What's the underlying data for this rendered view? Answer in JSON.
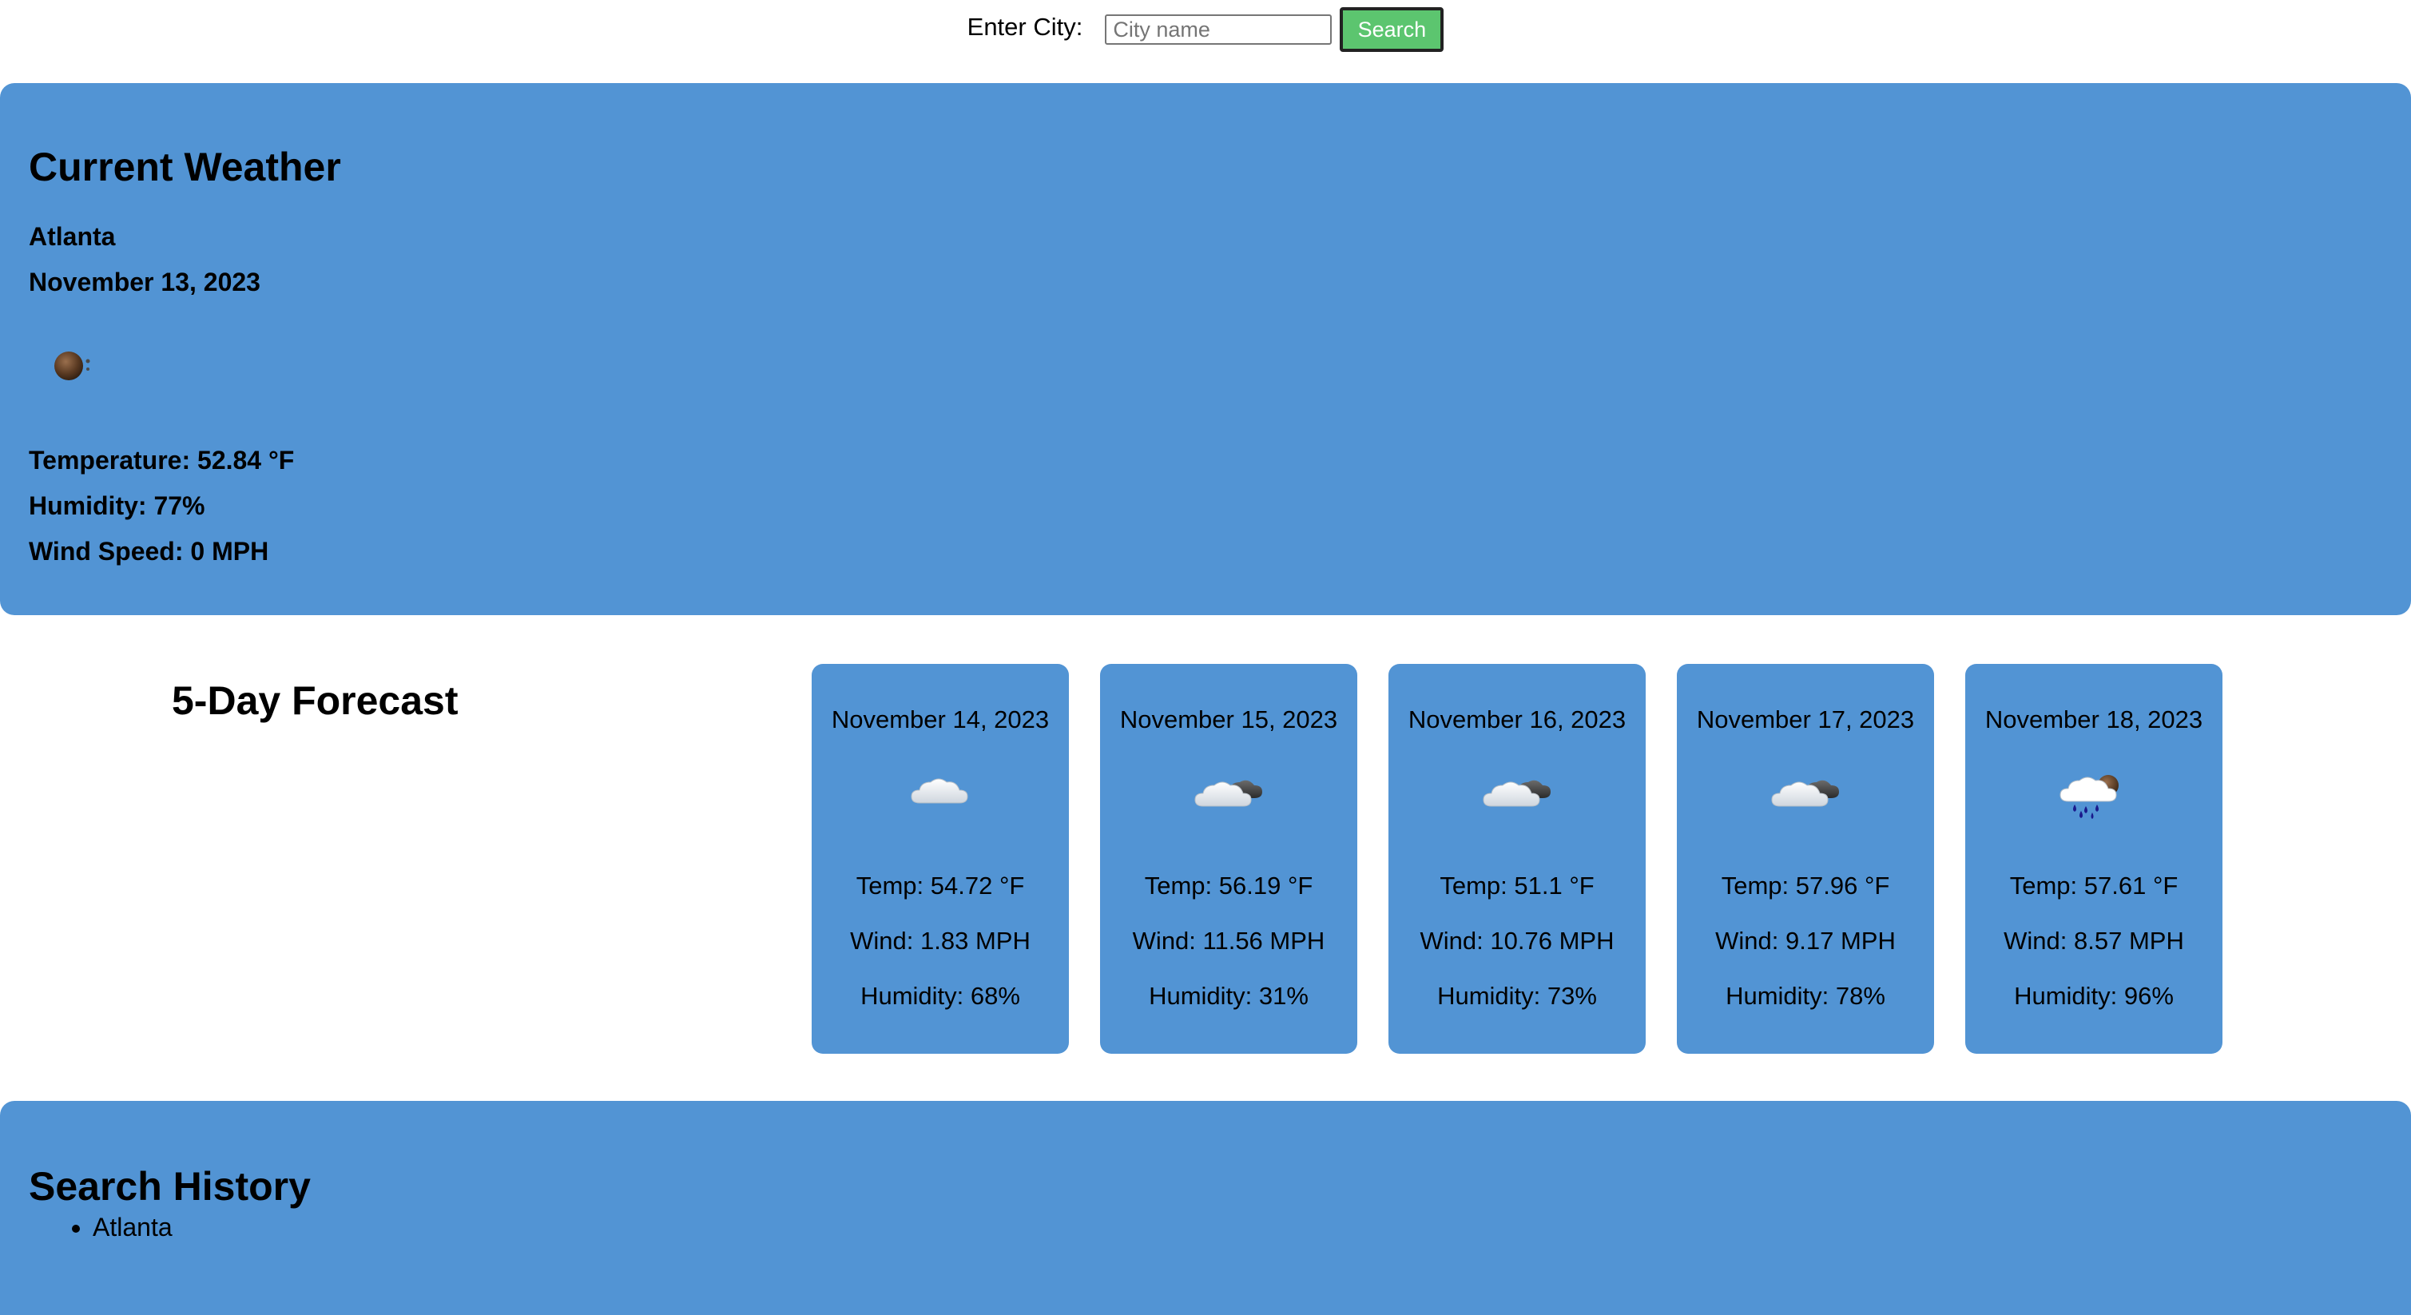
{
  "search": {
    "label": "Enter City:",
    "placeholder": "City name",
    "value": "",
    "button_label": "Search"
  },
  "current": {
    "title": "Current Weather",
    "city": "Atlanta",
    "date": "November 13, 2023",
    "icon": "night-clear-icon",
    "temperature": "Temperature: 52.84 °F",
    "humidity": "Humidity: 77%",
    "wind": "Wind Speed: 0 MPH"
  },
  "forecast": {
    "title": "5-Day Forecast",
    "days": [
      {
        "date": "November 14, 2023",
        "icon": "cloud-icon",
        "temp": "Temp: 54.72 °F",
        "wind": "Wind: 1.83 MPH",
        "humidity": "Humidity: 68%"
      },
      {
        "date": "November 15, 2023",
        "icon": "broken-clouds-icon",
        "temp": "Temp: 56.19 °F",
        "wind": "Wind: 11.56 MPH",
        "humidity": "Humidity: 31%"
      },
      {
        "date": "November 16, 2023",
        "icon": "broken-clouds-icon",
        "temp": "Temp: 51.1 °F",
        "wind": "Wind: 10.76 MPH",
        "humidity": "Humidity: 73%"
      },
      {
        "date": "November 17, 2023",
        "icon": "broken-clouds-icon",
        "temp": "Temp: 57.96 °F",
        "wind": "Wind: 9.17 MPH",
        "humidity": "Humidity: 78%"
      },
      {
        "date": "November 18, 2023",
        "icon": "rain-night-icon",
        "temp": "Temp: 57.61 °F",
        "wind": "Wind: 8.57 MPH",
        "humidity": "Humidity: 96%"
      }
    ]
  },
  "history": {
    "title": "Search History",
    "items": [
      "Atlanta"
    ]
  },
  "colors": {
    "panel": "#5294d4",
    "search_button": "#5cc56f"
  }
}
